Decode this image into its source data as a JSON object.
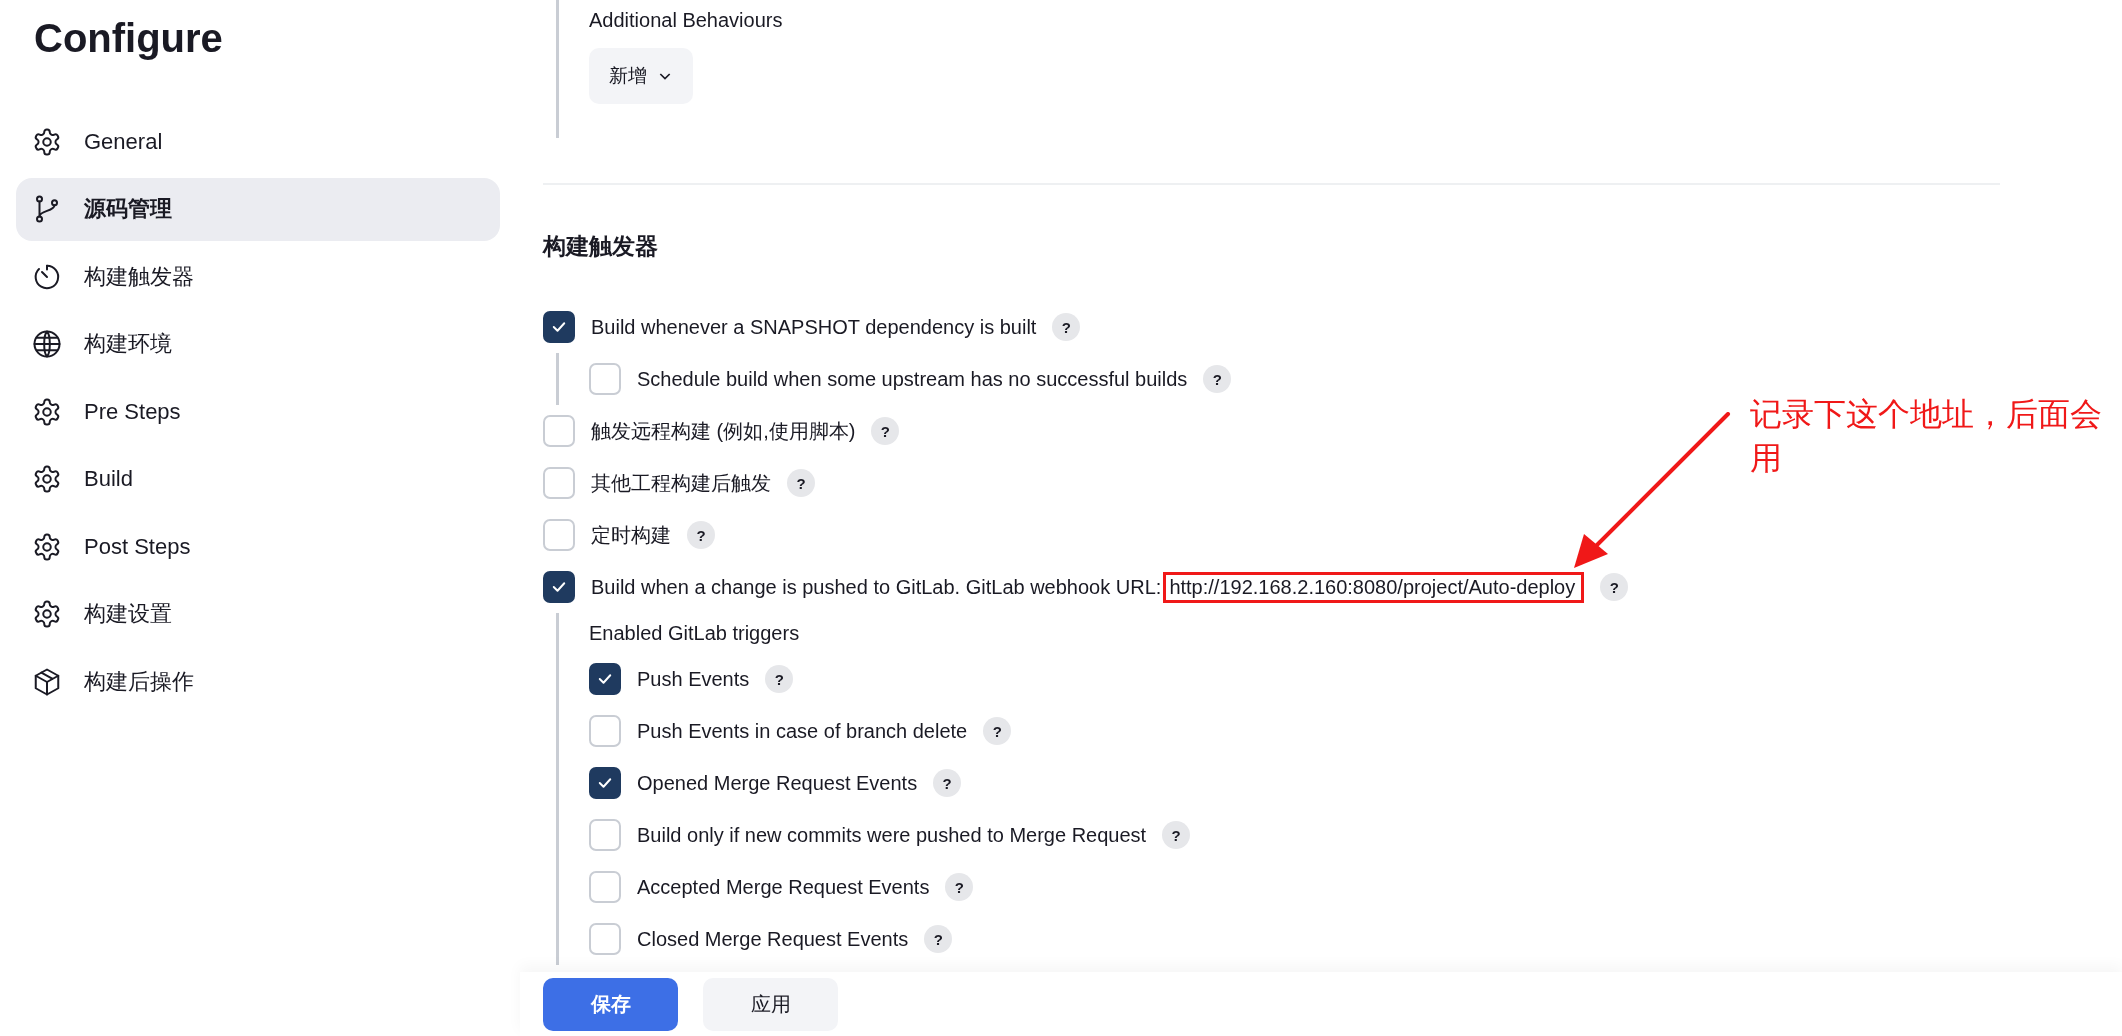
{
  "sidebar": {
    "title": "Configure",
    "items": [
      {
        "label": "General",
        "kind": "gear",
        "selected": false
      },
      {
        "label": "源码管理",
        "kind": "branch",
        "selected": true
      },
      {
        "label": "构建触发器",
        "kind": "timer",
        "selected": false
      },
      {
        "label": "构建环境",
        "kind": "globe",
        "selected": false
      },
      {
        "label": "Pre Steps",
        "kind": "gear",
        "selected": false
      },
      {
        "label": "Build",
        "kind": "gear",
        "selected": false
      },
      {
        "label": "Post Steps",
        "kind": "gear",
        "selected": false
      },
      {
        "label": "构建设置",
        "kind": "gear",
        "selected": false
      },
      {
        "label": "构建后操作",
        "kind": "package",
        "selected": false
      }
    ]
  },
  "scm": {
    "label": "Additional Behaviours",
    "add_button": "新增"
  },
  "triggers": {
    "heading": "构建触发器",
    "items": [
      {
        "label": "Build whenever a SNAPSHOT dependency is built",
        "checked": true,
        "help": "?",
        "children": [
          {
            "label": "Schedule build when some upstream has no successful builds",
            "checked": false,
            "help": "?"
          }
        ]
      },
      {
        "label": "触发远程构建 (例如,使用脚本)",
        "checked": false,
        "help": "?"
      },
      {
        "label": "其他工程构建后触发",
        "checked": false,
        "help": "?"
      },
      {
        "label": "定时构建",
        "checked": false,
        "help": "?"
      },
      {
        "label": "Build when a change is pushed to GitLab. GitLab webhook URL:",
        "url": "http://192.168.2.160:8080/project/Auto-deploy",
        "checked": true,
        "help": "?",
        "sublabel": "Enabled GitLab triggers",
        "children": [
          {
            "label": "Push Events",
            "checked": true,
            "help": "?"
          },
          {
            "label": "Push Events in case of branch delete",
            "checked": false,
            "help": "?"
          },
          {
            "label": "Opened Merge Request Events",
            "checked": true,
            "help": "?"
          },
          {
            "label": "Build only if new commits were pushed to Merge Request",
            "checked": false,
            "help": "?"
          },
          {
            "label": "Accepted Merge Request Events",
            "checked": false,
            "help": "?"
          },
          {
            "label": "Closed Merge Request Events",
            "checked": false,
            "help": "?"
          }
        ]
      }
    ]
  },
  "annotation": {
    "text": "记录下这个地址，后面会用"
  },
  "footer": {
    "buttons": [
      {
        "label": "保存",
        "kind": "primary"
      },
      {
        "label": "应用",
        "kind": "secondary"
      }
    ]
  }
}
